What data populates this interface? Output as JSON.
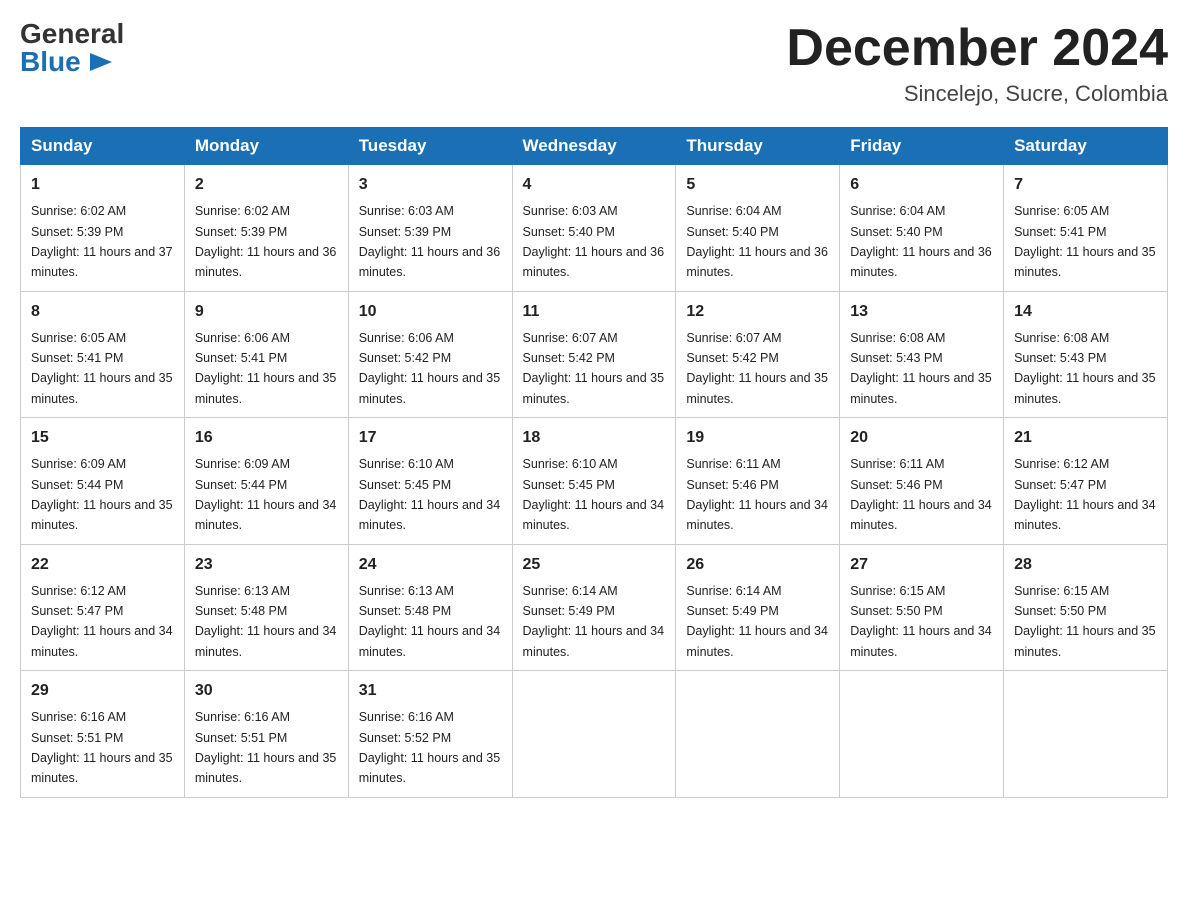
{
  "header": {
    "title": "December 2024",
    "location": "Sincelejo, Sucre, Colombia",
    "logo_general": "General",
    "logo_blue": "Blue"
  },
  "days_of_week": [
    "Sunday",
    "Monday",
    "Tuesday",
    "Wednesday",
    "Thursday",
    "Friday",
    "Saturday"
  ],
  "weeks": [
    [
      {
        "day": "1",
        "sunrise": "6:02 AM",
        "sunset": "5:39 PM",
        "daylight": "11 hours and 37 minutes."
      },
      {
        "day": "2",
        "sunrise": "6:02 AM",
        "sunset": "5:39 PM",
        "daylight": "11 hours and 36 minutes."
      },
      {
        "day": "3",
        "sunrise": "6:03 AM",
        "sunset": "5:39 PM",
        "daylight": "11 hours and 36 minutes."
      },
      {
        "day": "4",
        "sunrise": "6:03 AM",
        "sunset": "5:40 PM",
        "daylight": "11 hours and 36 minutes."
      },
      {
        "day": "5",
        "sunrise": "6:04 AM",
        "sunset": "5:40 PM",
        "daylight": "11 hours and 36 minutes."
      },
      {
        "day": "6",
        "sunrise": "6:04 AM",
        "sunset": "5:40 PM",
        "daylight": "11 hours and 36 minutes."
      },
      {
        "day": "7",
        "sunrise": "6:05 AM",
        "sunset": "5:41 PM",
        "daylight": "11 hours and 35 minutes."
      }
    ],
    [
      {
        "day": "8",
        "sunrise": "6:05 AM",
        "sunset": "5:41 PM",
        "daylight": "11 hours and 35 minutes."
      },
      {
        "day": "9",
        "sunrise": "6:06 AM",
        "sunset": "5:41 PM",
        "daylight": "11 hours and 35 minutes."
      },
      {
        "day": "10",
        "sunrise": "6:06 AM",
        "sunset": "5:42 PM",
        "daylight": "11 hours and 35 minutes."
      },
      {
        "day": "11",
        "sunrise": "6:07 AM",
        "sunset": "5:42 PM",
        "daylight": "11 hours and 35 minutes."
      },
      {
        "day": "12",
        "sunrise": "6:07 AM",
        "sunset": "5:42 PM",
        "daylight": "11 hours and 35 minutes."
      },
      {
        "day": "13",
        "sunrise": "6:08 AM",
        "sunset": "5:43 PM",
        "daylight": "11 hours and 35 minutes."
      },
      {
        "day": "14",
        "sunrise": "6:08 AM",
        "sunset": "5:43 PM",
        "daylight": "11 hours and 35 minutes."
      }
    ],
    [
      {
        "day": "15",
        "sunrise": "6:09 AM",
        "sunset": "5:44 PM",
        "daylight": "11 hours and 35 minutes."
      },
      {
        "day": "16",
        "sunrise": "6:09 AM",
        "sunset": "5:44 PM",
        "daylight": "11 hours and 34 minutes."
      },
      {
        "day": "17",
        "sunrise": "6:10 AM",
        "sunset": "5:45 PM",
        "daylight": "11 hours and 34 minutes."
      },
      {
        "day": "18",
        "sunrise": "6:10 AM",
        "sunset": "5:45 PM",
        "daylight": "11 hours and 34 minutes."
      },
      {
        "day": "19",
        "sunrise": "6:11 AM",
        "sunset": "5:46 PM",
        "daylight": "11 hours and 34 minutes."
      },
      {
        "day": "20",
        "sunrise": "6:11 AM",
        "sunset": "5:46 PM",
        "daylight": "11 hours and 34 minutes."
      },
      {
        "day": "21",
        "sunrise": "6:12 AM",
        "sunset": "5:47 PM",
        "daylight": "11 hours and 34 minutes."
      }
    ],
    [
      {
        "day": "22",
        "sunrise": "6:12 AM",
        "sunset": "5:47 PM",
        "daylight": "11 hours and 34 minutes."
      },
      {
        "day": "23",
        "sunrise": "6:13 AM",
        "sunset": "5:48 PM",
        "daylight": "11 hours and 34 minutes."
      },
      {
        "day": "24",
        "sunrise": "6:13 AM",
        "sunset": "5:48 PM",
        "daylight": "11 hours and 34 minutes."
      },
      {
        "day": "25",
        "sunrise": "6:14 AM",
        "sunset": "5:49 PM",
        "daylight": "11 hours and 34 minutes."
      },
      {
        "day": "26",
        "sunrise": "6:14 AM",
        "sunset": "5:49 PM",
        "daylight": "11 hours and 34 minutes."
      },
      {
        "day": "27",
        "sunrise": "6:15 AM",
        "sunset": "5:50 PM",
        "daylight": "11 hours and 34 minutes."
      },
      {
        "day": "28",
        "sunrise": "6:15 AM",
        "sunset": "5:50 PM",
        "daylight": "11 hours and 35 minutes."
      }
    ],
    [
      {
        "day": "29",
        "sunrise": "6:16 AM",
        "sunset": "5:51 PM",
        "daylight": "11 hours and 35 minutes."
      },
      {
        "day": "30",
        "sunrise": "6:16 AM",
        "sunset": "5:51 PM",
        "daylight": "11 hours and 35 minutes."
      },
      {
        "day": "31",
        "sunrise": "6:16 AM",
        "sunset": "5:52 PM",
        "daylight": "11 hours and 35 minutes."
      },
      null,
      null,
      null,
      null
    ]
  ],
  "labels": {
    "sunrise_prefix": "Sunrise: ",
    "sunset_prefix": "Sunset: ",
    "daylight_prefix": "Daylight: "
  }
}
